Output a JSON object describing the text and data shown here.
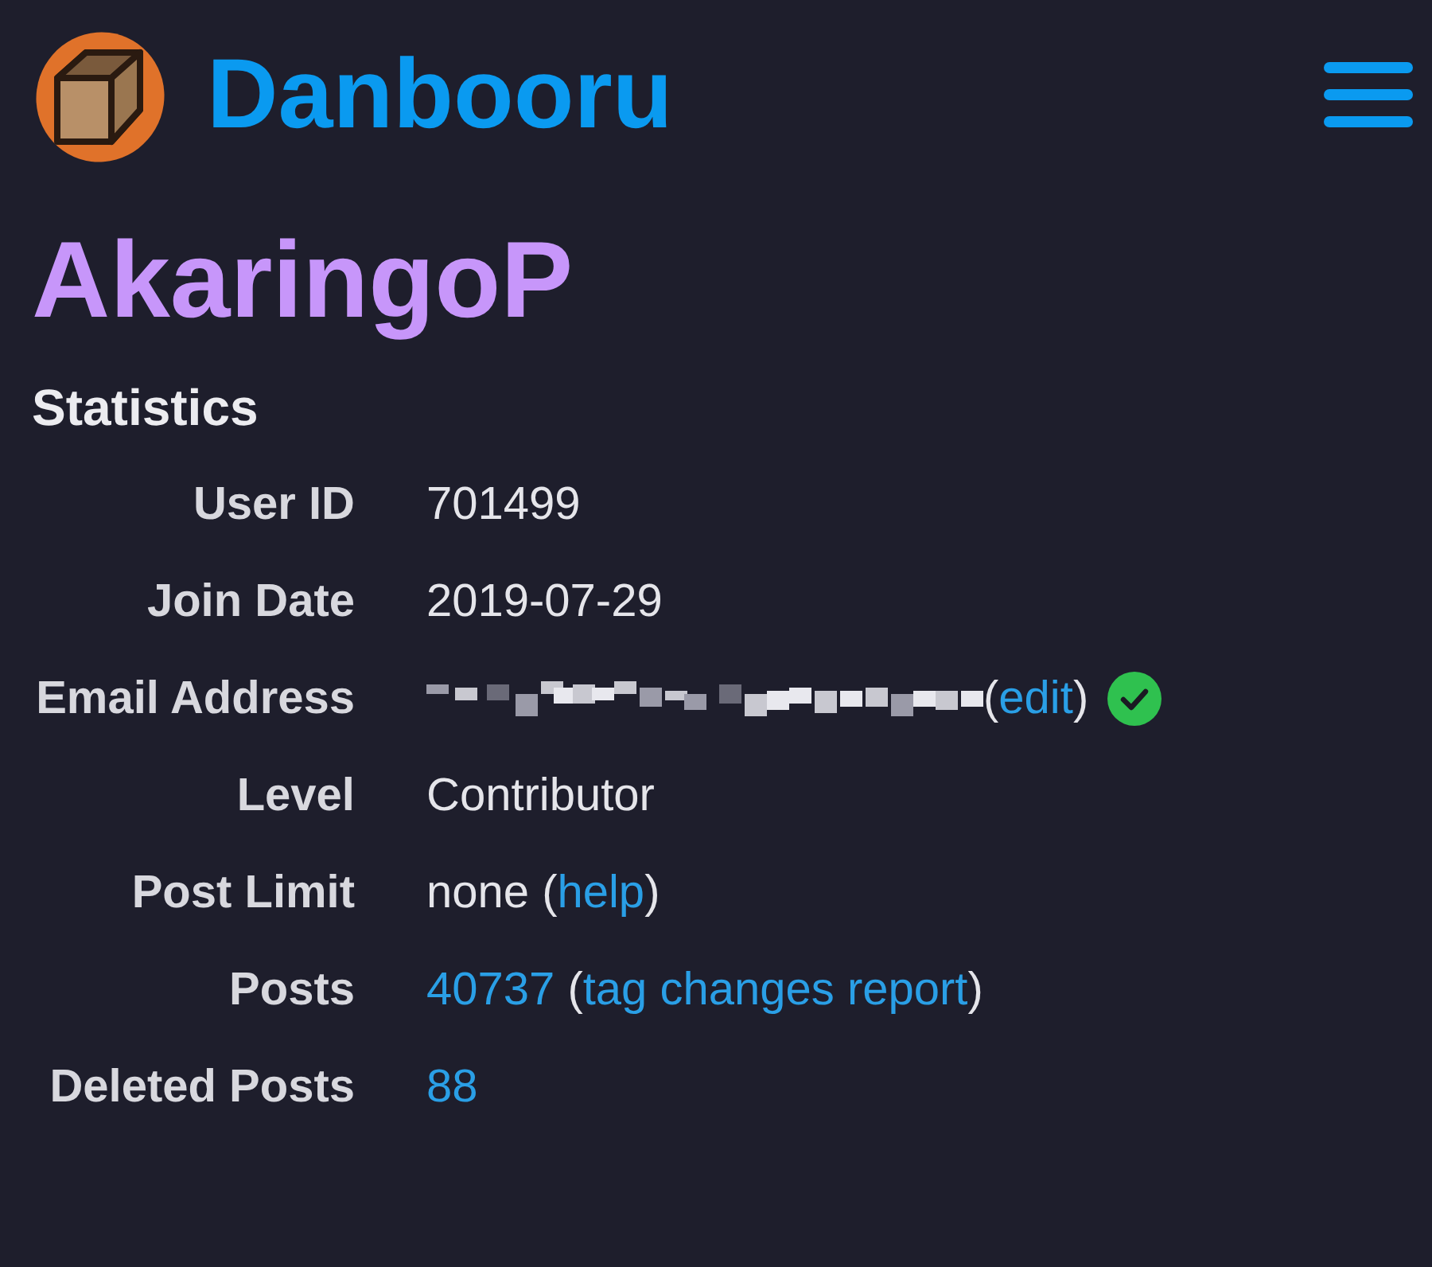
{
  "site": {
    "title": "Danbooru"
  },
  "user": {
    "name": "AkaringoP"
  },
  "section": {
    "heading": "Statistics"
  },
  "rows": [
    {
      "label": "User ID",
      "parts": [
        {
          "kind": "text",
          "text": "701499"
        }
      ]
    },
    {
      "label": "Join Date",
      "parts": [
        {
          "kind": "text",
          "text": "2019-07-29"
        }
      ]
    },
    {
      "label": "Email Address",
      "parts": [
        {
          "kind": "redacted"
        },
        {
          "kind": "text",
          "text": "("
        },
        {
          "kind": "link",
          "text": "edit"
        },
        {
          "kind": "text",
          "text": ")"
        },
        {
          "kind": "verified"
        }
      ]
    },
    {
      "label": "Level",
      "parts": [
        {
          "kind": "text",
          "text": "Contributor"
        }
      ]
    },
    {
      "label": "Post Limit",
      "parts": [
        {
          "kind": "text",
          "text": "none ("
        },
        {
          "kind": "link",
          "text": "help"
        },
        {
          "kind": "text",
          "text": ")"
        }
      ]
    },
    {
      "label": "Posts",
      "parts": [
        {
          "kind": "link",
          "text": "40737"
        },
        {
          "kind": "text",
          "text": " ("
        },
        {
          "kind": "link",
          "text": "tag changes report"
        },
        {
          "kind": "text",
          "text": ")"
        }
      ]
    },
    {
      "label": "Deleted Posts",
      "parts": [
        {
          "kind": "link",
          "text": "88"
        }
      ]
    }
  ]
}
